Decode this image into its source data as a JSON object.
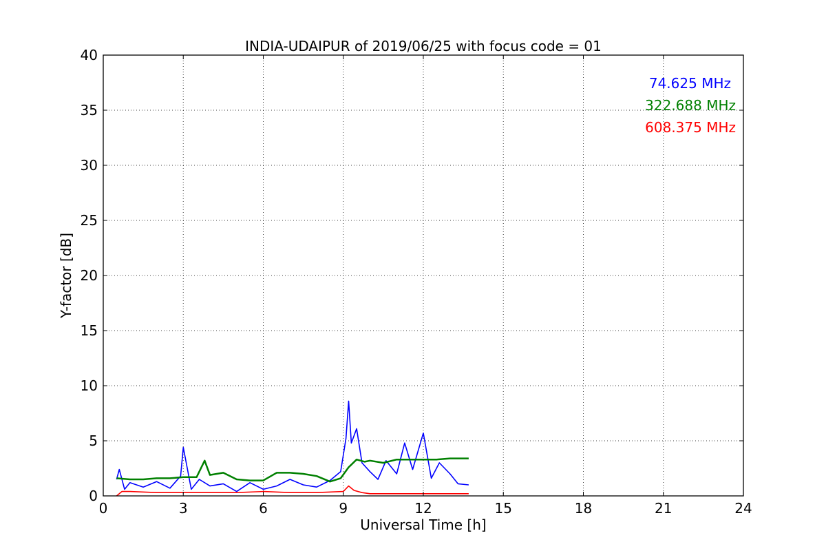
{
  "chart_data": {
    "type": "line",
    "title": "INDIA-UDAIPUR of 2019/06/25 with focus code = 01",
    "xlabel": "Universal Time [h]",
    "ylabel": "Y-factor [dB]",
    "xlim": [
      0,
      24
    ],
    "ylim": [
      0,
      40
    ],
    "xticks": [
      0,
      3,
      6,
      9,
      12,
      15,
      18,
      21,
      24
    ],
    "yticks": [
      0,
      5,
      10,
      15,
      20,
      25,
      30,
      35,
      40
    ],
    "grid": true,
    "legend_position": "top-right",
    "series": [
      {
        "name": "74.625 MHz",
        "color": "#0000ff",
        "x": [
          0.5,
          0.6,
          0.8,
          1.0,
          1.5,
          2.0,
          2.5,
          2.9,
          3.0,
          3.3,
          3.6,
          4.0,
          4.5,
          5.0,
          5.5,
          6.0,
          6.5,
          7.0,
          7.5,
          8.0,
          8.5,
          8.9,
          9.1,
          9.2,
          9.3,
          9.5,
          9.7,
          10.0,
          10.3,
          10.6,
          11.0,
          11.3,
          11.6,
          12.0,
          12.3,
          12.6,
          13.0,
          13.3,
          13.7
        ],
        "y": [
          1.5,
          2.4,
          0.6,
          1.2,
          0.8,
          1.3,
          0.7,
          1.8,
          4.4,
          0.6,
          1.5,
          0.9,
          1.1,
          0.4,
          1.2,
          0.6,
          0.9,
          1.5,
          1.0,
          0.8,
          1.4,
          2.2,
          5.2,
          8.6,
          4.8,
          6.1,
          3.0,
          2.2,
          1.5,
          3.2,
          2.0,
          4.8,
          2.4,
          5.7,
          1.6,
          3.0,
          2.0,
          1.1,
          1.0
        ]
      },
      {
        "name": "322.688 MHz",
        "color": "#008000",
        "x": [
          0.5,
          1.0,
          1.5,
          2.0,
          2.5,
          3.0,
          3.5,
          3.8,
          4.0,
          4.5,
          5.0,
          5.5,
          6.0,
          6.5,
          7.0,
          7.5,
          8.0,
          8.5,
          8.9,
          9.2,
          9.5,
          9.8,
          10.0,
          10.5,
          11.0,
          11.5,
          12.0,
          12.5,
          13.0,
          13.7
        ],
        "y": [
          1.6,
          1.5,
          1.5,
          1.6,
          1.6,
          1.7,
          1.7,
          3.2,
          1.9,
          2.1,
          1.5,
          1.4,
          1.4,
          2.1,
          2.1,
          2.0,
          1.8,
          1.3,
          1.6,
          2.6,
          3.3,
          3.1,
          3.2,
          3.0,
          3.3,
          3.3,
          3.3,
          3.3,
          3.4,
          3.4
        ]
      },
      {
        "name": "608.375 MHz",
        "color": "#ff0000",
        "x": [
          0.5,
          0.7,
          1.0,
          2.0,
          3.0,
          4.0,
          5.0,
          6.0,
          7.0,
          8.0,
          9.0,
          9.2,
          9.4,
          9.7,
          10.0,
          11.0,
          12.0,
          13.0,
          13.7
        ],
        "y": [
          0.0,
          0.4,
          0.4,
          0.3,
          0.3,
          0.3,
          0.3,
          0.4,
          0.3,
          0.3,
          0.4,
          0.9,
          0.5,
          0.3,
          0.2,
          0.2,
          0.2,
          0.2,
          0.2
        ]
      }
    ]
  }
}
